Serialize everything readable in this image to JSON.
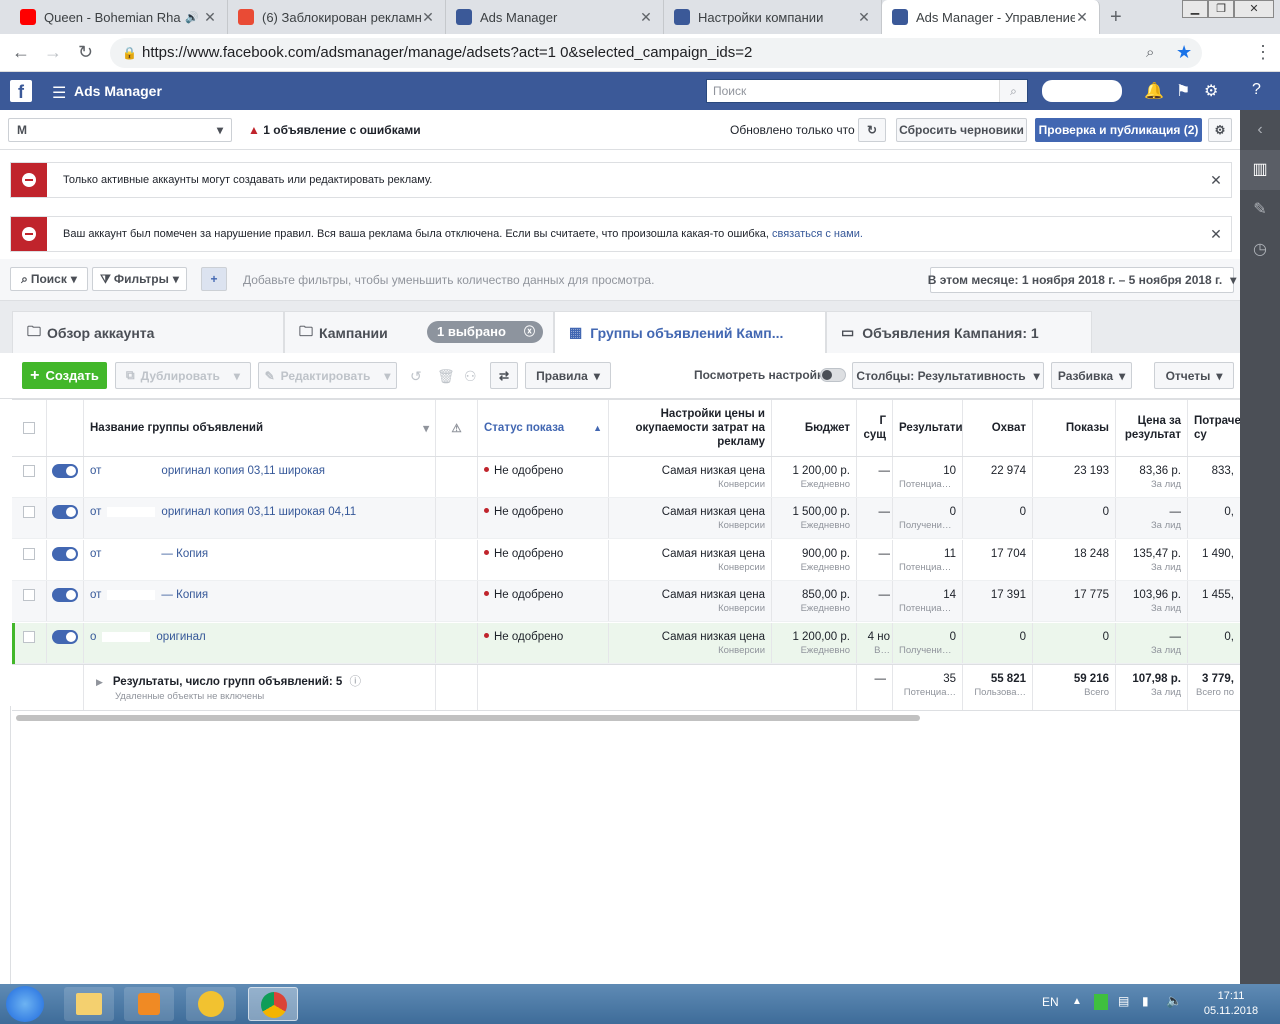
{
  "browser": {
    "tabs": [
      {
        "title": "Queen - Bohemian Rhap",
        "fav": "#ff0000"
      },
      {
        "title": "(6) Заблокирован рекламны",
        "fav": "#e94b35"
      },
      {
        "title": "Ads Manager",
        "fav": "#3b5998"
      },
      {
        "title": "Настройки компании",
        "fav": "#3b5998"
      },
      {
        "title": "Ads Manager - Управление",
        "fav": "#3b5998"
      }
    ],
    "url": "https://www.facebook.com/adsmanager/manage/adsets?act=1          0&selected_campaign_ids=2"
  },
  "fb": {
    "app_title": "Ads Manager",
    "search_placeholder": "Поиск"
  },
  "toolbar": {
    "account": "M",
    "error_text": "1 объявление с ошибками",
    "updated": "Обновлено только что",
    "reset": "Сбросить черновики",
    "publish": "Проверка и публикация (2)"
  },
  "alerts": [
    {
      "text": "Только активные аккаунты могут создавать или редактировать рекламу.",
      "link": ""
    },
    {
      "text": "Ваш аккаунт был помечен за нарушение правил. Вся ваша реклама была отключена. Если вы считаете, что произошла какая-то ошибка, ",
      "link": "связаться с нами."
    }
  ],
  "filters": {
    "search": "Поиск",
    "filters": "Фильтры",
    "add": "+",
    "hint": "Добавьте фильтры, чтобы уменьшить количество данных для просмотра.",
    "date": "В этом месяце: 1 ноября 2018 г. – 5 ноября 2018 г."
  },
  "page_tabs": {
    "overview": "Обзор аккаунта",
    "campaigns": "Кампании",
    "selected": "1 выбрано",
    "adsets": "Группы объявлений Камп...",
    "ads": "Объявления Кампания: 1"
  },
  "actions": {
    "create": "Создать",
    "duplicate": "Дублировать",
    "edit": "Редактировать",
    "rules": "Правила",
    "view_settings": "Посмотреть настройки",
    "columns": "Столбцы: Результативность",
    "breakdown": "Разбивка",
    "reports": "Отчеты"
  },
  "table": {
    "headers": {
      "name": "Название группы объявлений",
      "status": "Статус показа",
      "bid": "Настройки цены и окупаемости затрат на рекламу",
      "budget": "Бюджет",
      "last": "Г сущ",
      "results": "Результати",
      "reach": "Охват",
      "impr": "Показы",
      "cpr": "Цена за результат",
      "spent": "Потраче су"
    },
    "rows": [
      {
        "name_a": "от",
        "name_b": "оригинал копия 03,11 широкая",
        "status": "Не одобрено",
        "bid": "Самая низкая цена",
        "bid_sub": "Конверсии",
        "budget": "1 200,00 р.",
        "budget_sub": "Ежедневно",
        "last": "—",
        "res": "10",
        "res_sub": "Потенциа…",
        "reach": "22 974",
        "impr": "23 193",
        "cpr": "83,36 р.",
        "cpr_sub": "За лид",
        "spent": "833,"
      },
      {
        "name_a": "от",
        "name_b": "оригинал копия 03,11 широкая 04,11",
        "status": "Не одобрено",
        "bid": "Самая низкая цена",
        "bid_sub": "Конверсии",
        "budget": "1 500,00 р.",
        "budget_sub": "Ежедневно",
        "last": "—",
        "res": "0",
        "res_sub": "Получени…",
        "reach": "0",
        "impr": "0",
        "cpr": "—",
        "cpr_sub": "За лид",
        "spent": "0,"
      },
      {
        "name_a": "от",
        "name_b": "— Копия",
        "status": "Не одобрено",
        "bid": "Самая низкая цена",
        "bid_sub": "Конверсии",
        "budget": "900,00 р.",
        "budget_sub": "Ежедневно",
        "last": "—",
        "res": "11",
        "res_sub": "Потенциа…",
        "reach": "17 704",
        "impr": "18 248",
        "cpr": "135,47 р.",
        "cpr_sub": "За лид",
        "spent": "1 490,"
      },
      {
        "name_a": "от",
        "name_b": "— Копия",
        "status": "Не одобрено",
        "bid": "Самая низкая цена",
        "bid_sub": "Конверсии",
        "budget": "850,00 р.",
        "budget_sub": "Ежедневно",
        "last": "—",
        "res": "14",
        "res_sub": "Потенциа…",
        "reach": "17 391",
        "impr": "17 775",
        "cpr": "103,96 р.",
        "cpr_sub": "За лид",
        "spent": "1 455,"
      },
      {
        "name_a": "о",
        "name_b": "оригинал",
        "status": "Не одобрено",
        "bid": "Самая низкая цена",
        "bid_sub": "Конверсии",
        "budget": "1 200,00 р.",
        "budget_sub": "Ежедневно",
        "last": "4 но",
        "last_sub": "В…",
        "res": "0",
        "res_sub": "Получени…",
        "reach": "0",
        "impr": "0",
        "cpr": "—",
        "cpr_sub": "За лид",
        "spent": "0,"
      }
    ],
    "summary": {
      "title": "Результаты, число групп объявлений: 5",
      "sub": "Удаленные объекты не включены",
      "last": "—",
      "res": "35",
      "res_sub": "Потенциа…",
      "reach": "55 821",
      "reach_sub": "Пользова…",
      "impr": "59 216",
      "impr_sub": "Всего",
      "cpr": "107,98 р.",
      "cpr_sub": "За лид",
      "spent": "3 779,",
      "spent_sub": "Всего по"
    }
  },
  "taskbar": {
    "lang": "EN",
    "time": "17:11",
    "date": "05.11.2018"
  }
}
